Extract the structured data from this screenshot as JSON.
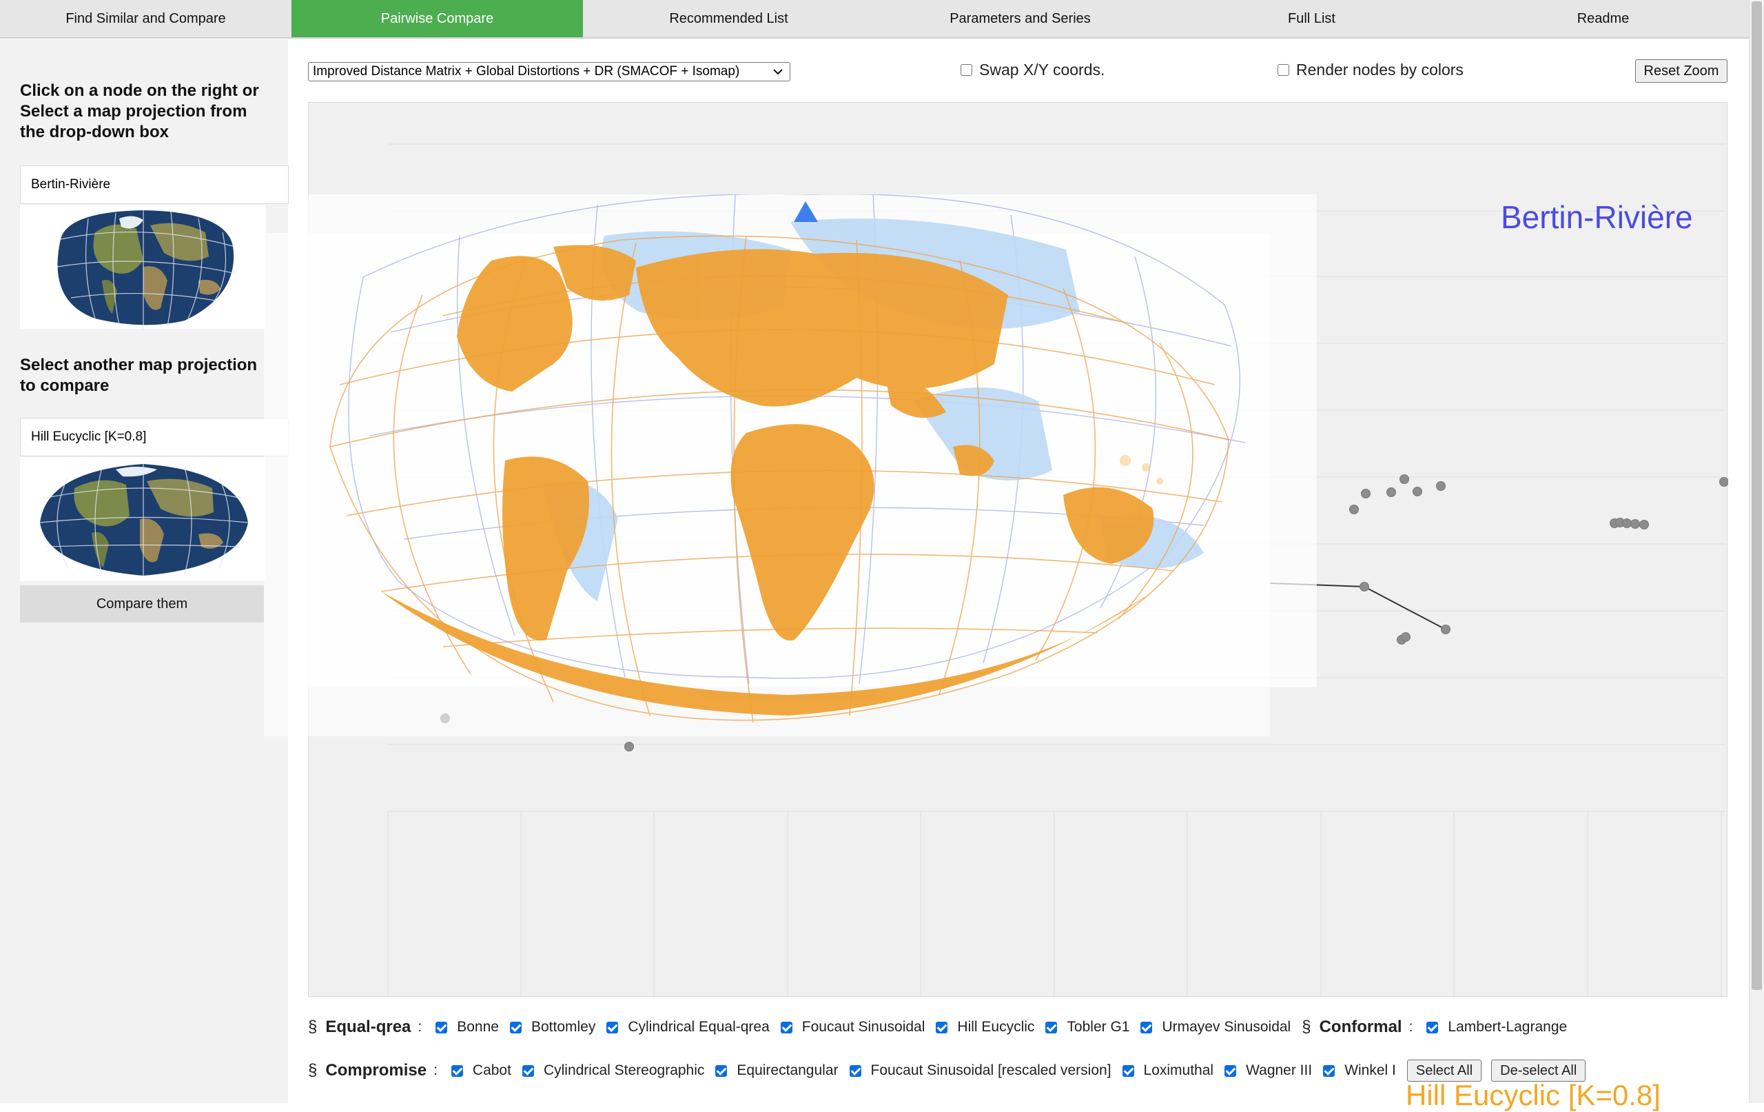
{
  "tabs": [
    {
      "label": "Find Similar and Compare",
      "active": false
    },
    {
      "label": "Pairwise Compare",
      "active": true
    },
    {
      "label": "Recommended List",
      "active": false
    },
    {
      "label": "Parameters and Series",
      "active": false
    },
    {
      "label": "Full List",
      "active": false
    },
    {
      "label": "Readme",
      "active": false
    }
  ],
  "sidebar": {
    "heading_1": "Click on a node on the right or Select a map projection from the drop-down box",
    "projection_1": "Bertin-Rivière",
    "heading_2": "Select another map projection to compare",
    "projection_2": "Hill Eucyclic [K=0.8]",
    "compare_button": "Compare them"
  },
  "controls": {
    "method_select": "Improved Distance Matrix + Global Distortions + DR (SMACOF + Isomap)",
    "swap_xy": {
      "label": "Swap X/Y coords.",
      "checked": false
    },
    "render_colors": {
      "label": "Render nodes by colors",
      "checked": false
    },
    "reset_zoom": "Reset Zoom"
  },
  "plot": {
    "label_a": "Bertin-Rivière",
    "label_b": "Hill Eucyclic [K=0.8]",
    "color_a": "#4b4bdc",
    "color_b": "#f5a623"
  },
  "legend": {
    "section_mark": "§",
    "colon": ":",
    "equal_area": {
      "title": "Equal-qrea",
      "items": [
        {
          "label": "Bonne",
          "checked": true
        },
        {
          "label": "Bottomley",
          "checked": true
        },
        {
          "label": "Cylindrical Equal-qrea",
          "checked": true
        },
        {
          "label": "Foucaut Sinusoidal",
          "checked": true
        },
        {
          "label": "Hill Eucyclic",
          "checked": true
        },
        {
          "label": "Tobler G1",
          "checked": true
        },
        {
          "label": "Urmayev Sinusoidal",
          "checked": true
        }
      ]
    },
    "conformal": {
      "title": "Conformal",
      "items": [
        {
          "label": "Lambert-Lagrange",
          "checked": true
        }
      ]
    },
    "compromise": {
      "title": "Compromise",
      "items": [
        {
          "label": "Cabot",
          "checked": true
        },
        {
          "label": "Cylindrical Stereographic",
          "checked": true
        },
        {
          "label": "Equirectangular",
          "checked": true
        },
        {
          "label": "Foucaut Sinusoidal [rescaled version]",
          "checked": true
        },
        {
          "label": "Loximuthal",
          "checked": true
        },
        {
          "label": "Wagner III",
          "checked": true
        },
        {
          "label": "Winkel I",
          "checked": true
        }
      ]
    },
    "select_all": "Select All",
    "deselect_all": "De-select All"
  }
}
